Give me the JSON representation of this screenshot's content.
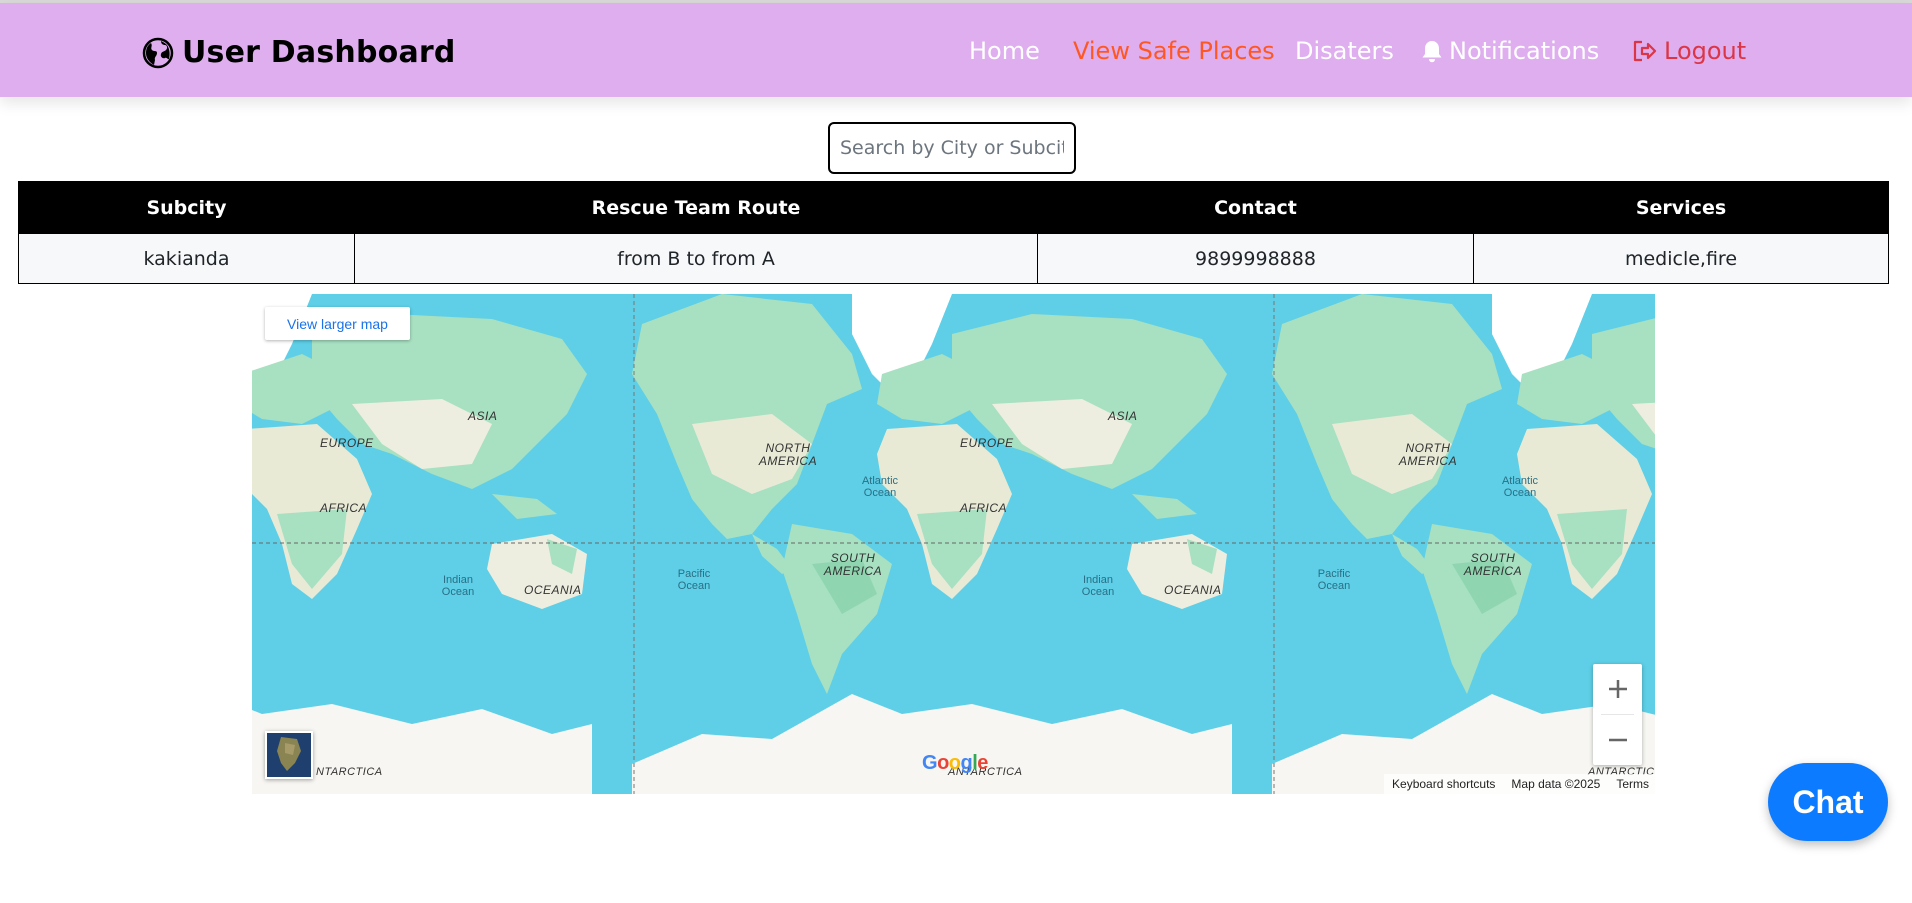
{
  "navbar": {
    "brand_title": "User Dashboard",
    "home": "Home",
    "safe_places": "View Safe Places",
    "disasters": "Disaters",
    "notifications": "Notifications",
    "logout": "Logout",
    "bg_color": "#deaeef",
    "active_color": "#ff5722",
    "logout_color": "#dc3545"
  },
  "search": {
    "placeholder": "Search by City or Subcity",
    "value": ""
  },
  "table": {
    "headers": [
      "Subcity",
      "Rescue Team Route",
      "Contact",
      "Services"
    ],
    "rows": [
      [
        "kakianda",
        "from B to from A",
        "9899998888",
        "medicle,fire"
      ]
    ]
  },
  "map": {
    "view_larger": "View larger map",
    "zoom_in": "+",
    "zoom_out": "−",
    "google": "Google",
    "keyboard_shortcuts": "Keyboard shortcuts",
    "map_data": "Map data ©2025",
    "terms": "Terms",
    "labels": {
      "asia": "ASIA",
      "europe": "EUROPE",
      "africa": "AFRICA",
      "north_america": "NORTH AMERICA",
      "south_america": "SOUTH AMERICA",
      "oceania": "OCEANIA",
      "antarctica": "ANTARCTICA",
      "antarctica_left": "NTARCTICA",
      "antarctica_right": "ANTARCTIC",
      "atlantic": "Atlantic Ocean",
      "pacific": "Pacific Ocean",
      "indian": "Indian Ocean"
    }
  },
  "chat_button": "Chat"
}
